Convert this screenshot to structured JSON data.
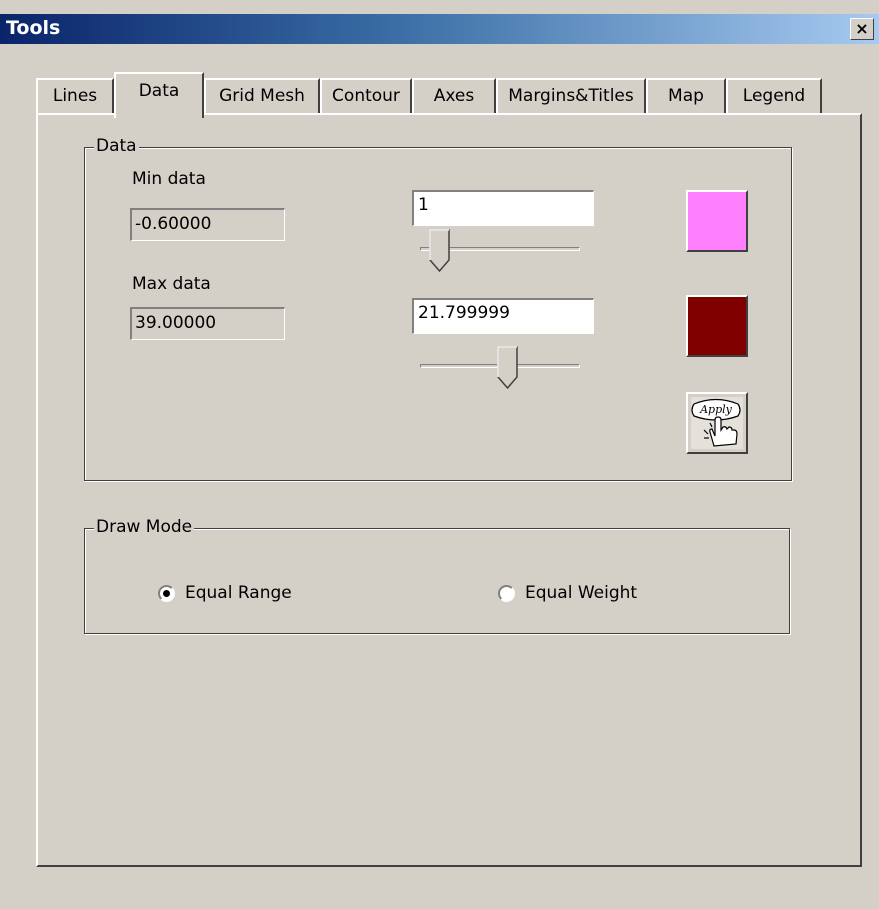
{
  "window": {
    "title": "Tools",
    "close_glyph": "×"
  },
  "tabs": [
    {
      "label": "Lines"
    },
    {
      "label": "Data"
    },
    {
      "label": "Grid Mesh"
    },
    {
      "label": "Contour"
    },
    {
      "label": "Axes"
    },
    {
      "label": "Margins&Titles"
    },
    {
      "label": "Map"
    },
    {
      "label": "Legend"
    }
  ],
  "active_tab": "Data",
  "data_group": {
    "title": "Data",
    "min_label": "Min data",
    "min_value": "-0.60000",
    "max_label": "Max data",
    "max_value": "39.00000",
    "min_input": "1",
    "max_input": "21.799999",
    "min_slider_fraction": 0.06,
    "max_slider_fraction": 0.56,
    "min_color": "#ff80ff",
    "max_color": "#800000",
    "apply_icon": "apply-hand-icon"
  },
  "draw_mode": {
    "title": "Draw Mode",
    "options": [
      {
        "label": "Equal Range",
        "selected": true
      },
      {
        "label": "Equal Weight",
        "selected": false
      }
    ]
  }
}
